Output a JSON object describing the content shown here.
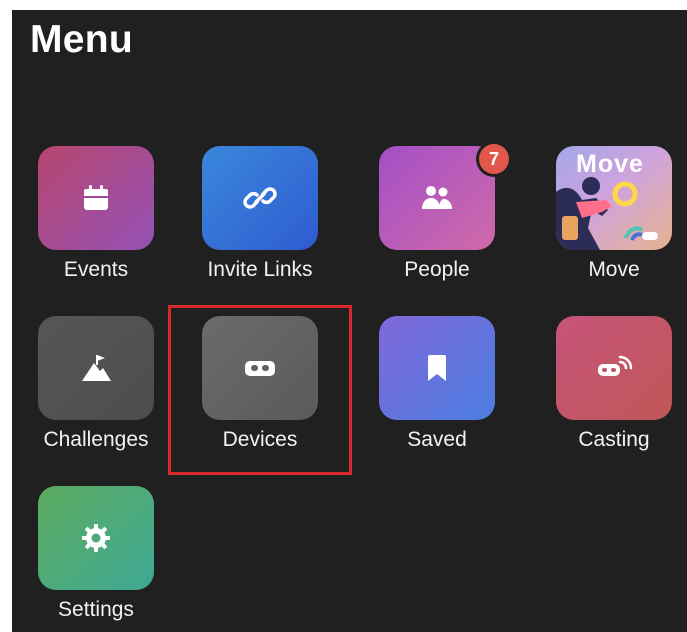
{
  "page": {
    "title": "Menu"
  },
  "menu": {
    "items": [
      {
        "label": "Events",
        "icon": "calendar-icon",
        "colors": [
          "#b7466f",
          "#9451b5"
        ]
      },
      {
        "label": "Invite Links",
        "icon": "link-icon",
        "colors": [
          "#3a88db",
          "#2f5bd1"
        ]
      },
      {
        "label": "People",
        "icon": "people-icon",
        "colors": [
          "#a44fc8",
          "#cf6aa8"
        ],
        "badge": "7"
      },
      {
        "label": "Move",
        "icon": "move-thumbnail",
        "thumbnail_text": "Move"
      },
      {
        "label": "Challenges",
        "icon": "mountain-flag-icon",
        "colors": [
          "#565656",
          "#4d4d4d"
        ]
      },
      {
        "label": "Devices",
        "icon": "vr-headset-icon",
        "colors": [
          "#6b6b6b",
          "#5a5a5a"
        ]
      },
      {
        "label": "Saved",
        "icon": "bookmark-icon",
        "colors": [
          "#8068da",
          "#4c7ee1"
        ]
      },
      {
        "label": "Casting",
        "icon": "cast-icon",
        "colors": [
          "#c6547a",
          "#c05757"
        ]
      },
      {
        "label": "Settings",
        "icon": "gear-icon",
        "colors": [
          "#5dac5f",
          "#3ea894"
        ]
      }
    ]
  },
  "highlight": {
    "target": "Devices",
    "color": "#d8282f"
  }
}
